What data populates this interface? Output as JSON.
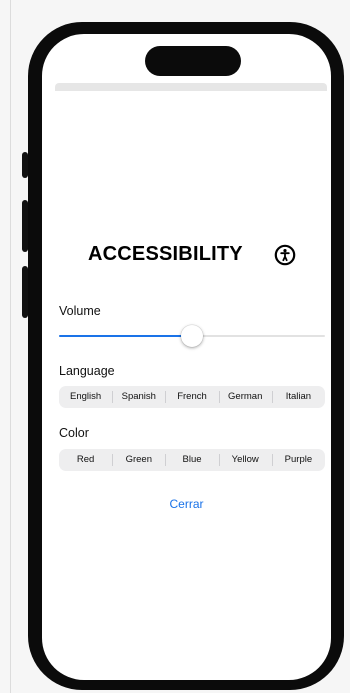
{
  "screen": {
    "title": "ACCESSIBILITY",
    "accessibility_icon": "accessibility-icon"
  },
  "volume": {
    "label": "Volume",
    "value": 0.5,
    "accent": "#1a73e8"
  },
  "language": {
    "label": "Language",
    "options": [
      "English",
      "Spanish",
      "French",
      "German",
      "Italian"
    ]
  },
  "color": {
    "label": "Color",
    "options": [
      "Red",
      "Green",
      "Blue",
      "Yellow",
      "Purple"
    ]
  },
  "close": {
    "label": "Cerrar"
  }
}
